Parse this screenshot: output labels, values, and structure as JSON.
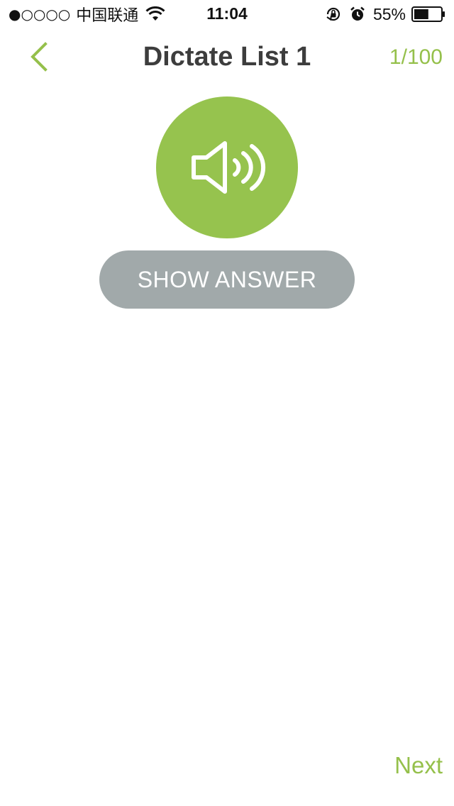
{
  "status_bar": {
    "signal_dots": "●○○○○",
    "carrier": "中国联通",
    "time": "11:04",
    "battery_percent": "55%",
    "icons": [
      "signal-dots-icon",
      "wifi-icon",
      "orientation-lock-icon",
      "alarm-icon",
      "battery-icon"
    ],
    "battery_level": 0.55
  },
  "nav": {
    "back_icon": "chevron-left-icon",
    "title": "Dictate List 1",
    "counter": "1/100"
  },
  "main": {
    "play_icon": "speaker-volume-icon",
    "show_answer_label": "SHOW ANSWER"
  },
  "footer": {
    "next_label": "Next"
  },
  "colors": {
    "accent_green": "#96c34e",
    "button_gray": "#a1a9aa",
    "title_text": "#3d3d3d",
    "background": "#ffffff"
  }
}
